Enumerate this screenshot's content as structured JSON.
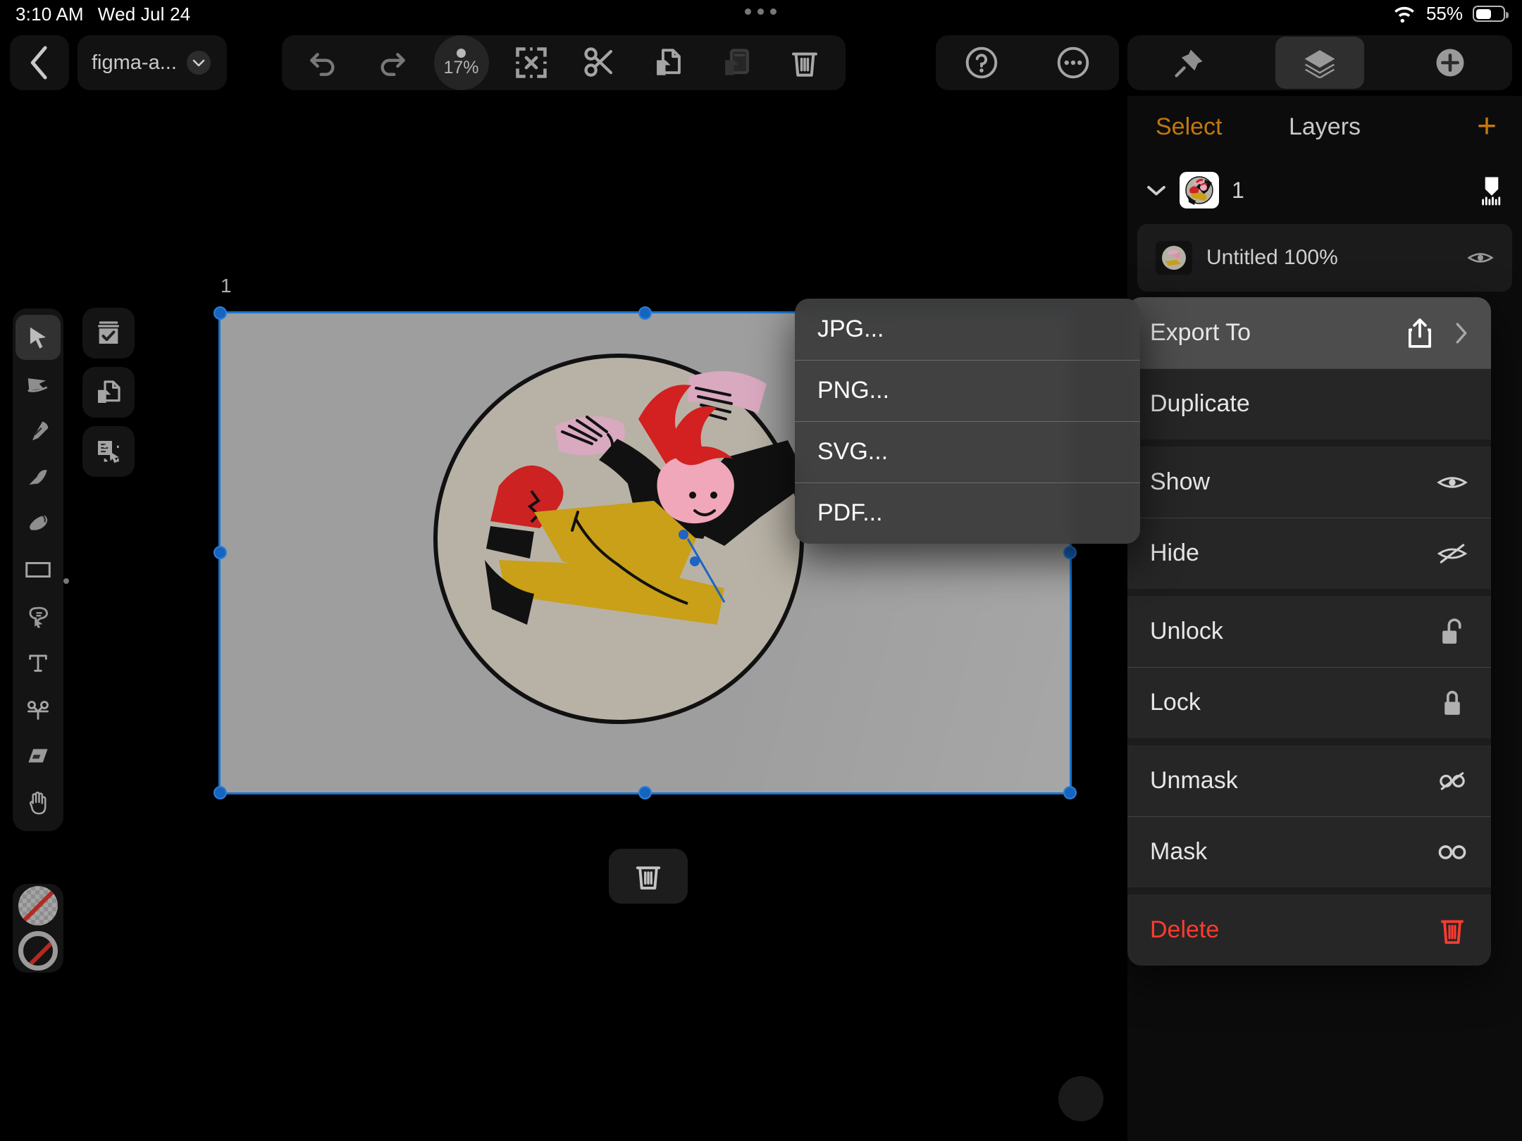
{
  "status_bar": {
    "time": "3:10 AM",
    "date": "Wed Jul 24",
    "battery_percent": "55%",
    "wifi_icon": "wifi-icon",
    "battery_icon": "battery-icon"
  },
  "toolbar": {
    "back_icon": "chevron-left-icon",
    "file_name": "figma-a...",
    "file_dropdown_icon": "chevron-down-icon",
    "undo_icon": "undo-icon",
    "redo_icon": "redo-icon",
    "zoom_level": "17%",
    "deselect_icon": "deselect-icon",
    "cut_icon": "scissors-icon",
    "copy_icon": "copy-icon",
    "paste_icon": "paste-icon",
    "delete_icon": "trash-icon",
    "help_icon": "question-circle-icon",
    "more_icon": "ellipsis-circle-icon",
    "pin_icon": "pin-icon",
    "layers_icon": "layers-icon",
    "add_icon": "plus-circle-icon"
  },
  "tools": [
    {
      "name": "select-tool",
      "icon": "arrow-cursor-icon",
      "active": true
    },
    {
      "name": "node-tool",
      "icon": "node-select-icon",
      "active": false
    },
    {
      "name": "pen-tool",
      "icon": "pen-nib-icon",
      "active": false
    },
    {
      "name": "pencil-tool",
      "icon": "pencil-icon",
      "active": false
    },
    {
      "name": "brush-tool",
      "icon": "paintbrush-icon",
      "active": false
    },
    {
      "name": "shape-tool",
      "icon": "rectangle-icon",
      "active": false
    },
    {
      "name": "shape-builder-tool",
      "icon": "shape-builder-icon",
      "active": false
    },
    {
      "name": "text-tool",
      "icon": "text-icon",
      "active": false
    },
    {
      "name": "scissors-tool",
      "icon": "scissors-icon",
      "active": false
    },
    {
      "name": "eraser-tool",
      "icon": "eraser-icon",
      "active": false
    },
    {
      "name": "hand-tool",
      "icon": "hand-icon",
      "active": false
    }
  ],
  "secondary_tools": [
    {
      "name": "select-all-button",
      "icon": "checkbox-icon"
    },
    {
      "name": "duplicate-button",
      "icon": "copy-pages-icon"
    },
    {
      "name": "select-similar-button",
      "icon": "select-similar-icon"
    }
  ],
  "color_wells": {
    "fill": {
      "name": "fill-color-well",
      "value": "none"
    },
    "stroke": {
      "name": "stroke-color-well",
      "value": "none"
    },
    "none_indicator_color": "#b02b22"
  },
  "canvas": {
    "artboard_label": "1",
    "artboard_fill": "#9e9e9e",
    "selection_color": "#1565c0",
    "delete_icon": "trash-icon"
  },
  "right_panel": {
    "select_label": "Select",
    "title": "Layers",
    "add_label": "+",
    "layer": {
      "expand_icon": "chevron-down-icon",
      "name": "1",
      "measure_icon": "ruler-icon"
    },
    "sublayer": {
      "name": "Untitled      100%",
      "eye_icon": "eye-icon"
    }
  },
  "context_menu": {
    "items": [
      {
        "label": "Export To",
        "icon": "share-icon",
        "highlighted": true,
        "has_submenu": true,
        "danger": false
      },
      {
        "label": "Duplicate",
        "icon": "",
        "highlighted": false,
        "has_submenu": false,
        "danger": false
      },
      {
        "label": "Show",
        "icon": "eye-icon",
        "highlighted": false,
        "has_submenu": false,
        "danger": false
      },
      {
        "label": "Hide",
        "icon": "eye-slash-icon",
        "highlighted": false,
        "has_submenu": false,
        "danger": false
      },
      {
        "label": "Unlock",
        "icon": "lock-open-icon",
        "highlighted": false,
        "has_submenu": false,
        "danger": false
      },
      {
        "label": "Lock",
        "icon": "lock-closed-icon",
        "highlighted": false,
        "has_submenu": false,
        "danger": false
      },
      {
        "label": "Unmask",
        "icon": "mask-slash-icon",
        "highlighted": false,
        "has_submenu": false,
        "danger": false
      },
      {
        "label": "Mask",
        "icon": "mask-icon",
        "highlighted": false,
        "has_submenu": false,
        "danger": false
      },
      {
        "label": "Delete",
        "icon": "trash-icon",
        "highlighted": false,
        "has_submenu": false,
        "danger": true
      }
    ]
  },
  "export_submenu": {
    "items": [
      {
        "label": "JPG..."
      },
      {
        "label": "PNG..."
      },
      {
        "label": "SVG..."
      },
      {
        "label": "PDF..."
      }
    ]
  }
}
